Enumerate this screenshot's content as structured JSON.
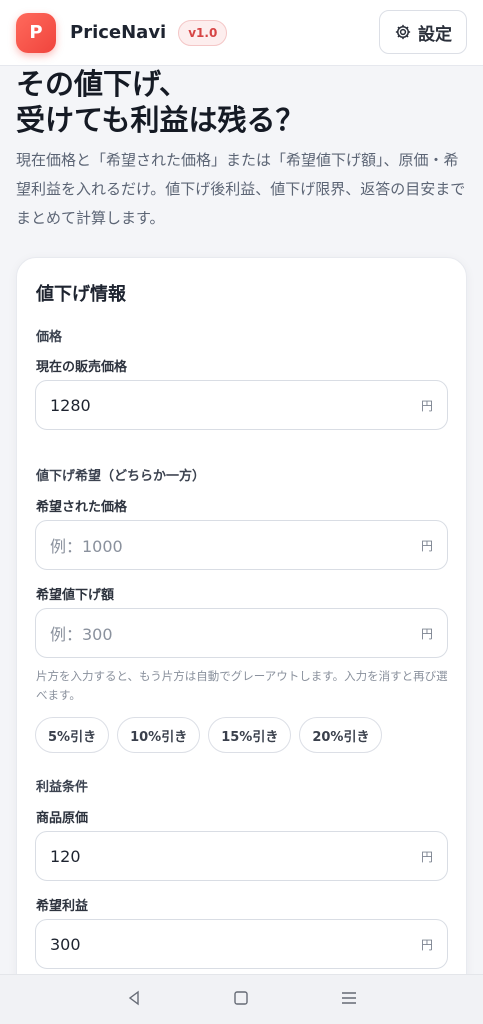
{
  "header": {
    "logo_letter": "P",
    "app_name": "PriceNavi",
    "version": "v1.0",
    "settings_label": "設定"
  },
  "hero": {
    "title": "その値下げ、\n受けても利益は残る？",
    "description": "現在価格と「希望された価格」または「希望値下げ額」、原価・希望利益を入れるだけ。値下げ後利益、値下げ限界、返答の目安までまとめて計算します。"
  },
  "form": {
    "card_title": "値下げ情報",
    "price_section": "価格",
    "current_price": {
      "label": "現在の販売価格",
      "value": "1280",
      "unit": "円"
    },
    "discount_section": "値下げ希望（どちらか一方）",
    "requested_price": {
      "label": "希望された価格",
      "placeholder": "例：1000",
      "unit": "円"
    },
    "requested_discount": {
      "label": "希望値下げ額",
      "placeholder": "例：300",
      "unit": "円"
    },
    "hint": "片方を入力すると、もう片方は自動でグレーアウトします。入力を消すと再び選べます。",
    "presets": [
      "5%引き",
      "10%引き",
      "15%引き",
      "20%引き"
    ],
    "profit_section": "利益条件",
    "cost": {
      "label": "商品原価",
      "value": "120",
      "unit": "円"
    },
    "target_profit": {
      "label": "希望利益",
      "value": "300",
      "unit": "円"
    }
  },
  "icons": {
    "settings": "gear-icon",
    "nav_back": "triangle-back-icon",
    "nav_home": "square-home-icon",
    "nav_menu": "menu-lines-icon"
  },
  "colors": {
    "brand": "#f0443d",
    "background": "#f4f5f8"
  }
}
